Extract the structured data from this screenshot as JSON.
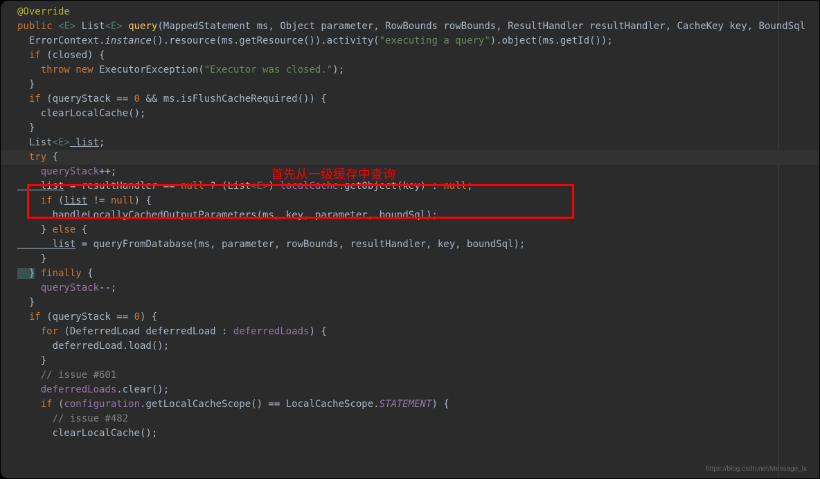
{
  "annotation": {
    "text1": "首先从一级缓存中查询"
  },
  "watermark": "https://blog.csdn.net/Message_lx",
  "code": {
    "l1_annotation": "@Override",
    "l2_public": "public",
    "l2_generic1": "<E>",
    "l2_list": " List",
    "l2_generic2": "<E>",
    "l2_method": " query",
    "l2_params": "(MappedStatement ms, Object parameter, RowBounds rowBounds, ResultHandler resultHandler, CacheKey key, BoundSql ",
    "l3_pre": "  ErrorContext.",
    "l3_instance": "instance",
    "l3_mid1": "().resource(ms.getResource()).activity(",
    "l3_str": "\"executing a query\"",
    "l3_mid2": ").object(ms.getId());",
    "l4_if": "  if",
    "l4_cond": " (closed) {",
    "l5_throw": "    throw new",
    "l5_exc": " ExecutorException(",
    "l5_str": "\"Executor was closed.\"",
    "l5_end": ");",
    "l6": "  }",
    "l7_if": "  if",
    "l7_cond": " (queryStack == ",
    "l7_zero": "0",
    "l7_and": " && ms.isFlushCacheRequired()) {",
    "l8": "    clearLocalCache();",
    "l9": "  }",
    "l10_list": "  List",
    "l10_gen": "<E>",
    "l10_var": " list",
    "l10_semi": ";",
    "l11_try": "  try",
    "l11_brace": " {",
    "l12_qs": "    queryStack",
    "l12_inc": "++;",
    "l13_list": "    list",
    "l13_eq": " = resultHandler == ",
    "l13_null1": "null",
    "l13_q": " ? (List",
    "l13_gen": "<E>",
    "l13_paren": ") ",
    "l13_cache": "localCache",
    "l13_get": ".getObject(key) : ",
    "l13_null2": "null",
    "l13_semi": ";",
    "l14_if": "    if",
    "l14_open": " (",
    "l14_list": "list",
    "l14_ne": " != ",
    "l14_null": "null",
    "l14_close": ") {",
    "l15": "      handleLocallyCachedOutputParameters(ms, key, parameter, boundSql);",
    "l16_close": "    } ",
    "l16_else": "else",
    "l16_brace": " {",
    "l17_list": "      list",
    "l17_rest": " = queryFromDatabase(ms, parameter, rowBounds, resultHandler, key, boundSql);",
    "l18": "    }",
    "l19_close": "  }",
    "l19_finally": " finally",
    "l19_brace": " {",
    "l20_qs": "    queryStack",
    "l20_dec": "--;",
    "l21": "  }",
    "l22_if": "  if",
    "l22_cond": " (queryStack == ",
    "l22_zero": "0",
    "l22_close": ") {",
    "l23_for": "    for",
    "l23_rest": " (DeferredLoad deferredLoad : ",
    "l23_field": "deferredLoads",
    "l23_close": ") {",
    "l24": "      deferredLoad.load();",
    "l25": "    }",
    "l26_comment": "    // issue #601",
    "l27_field": "    deferredLoads",
    "l27_rest": ".clear();",
    "l28_if": "    if",
    "l28_open": " (",
    "l28_config": "configuration",
    "l28_mid": ".getLocalCacheScope() == LocalCacheScope.",
    "l28_stmt": "STATEMENT",
    "l28_close": ") {",
    "l29_comment": "      // issue #482",
    "l30": "      clearLocalCache();"
  }
}
